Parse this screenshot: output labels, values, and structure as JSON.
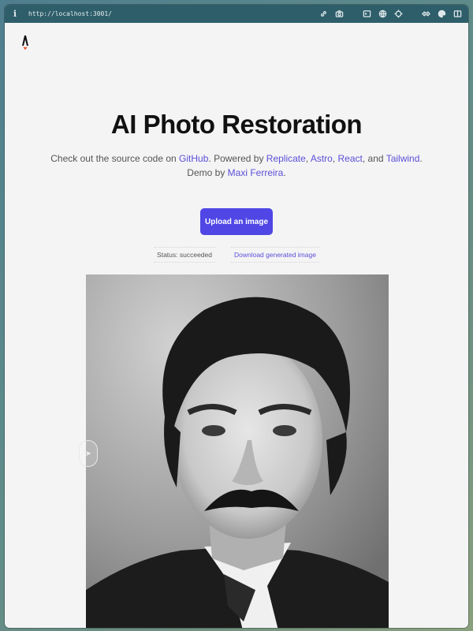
{
  "browser": {
    "url": "http://localhost:3001/",
    "icons": [
      "link-icon",
      "camera-icon",
      "terminal-icon",
      "globe-icon",
      "crosshair-icon",
      "code-icon",
      "palette-icon",
      "sidebar-icon"
    ]
  },
  "header": {
    "logo": "astro-logo-icon"
  },
  "main": {
    "title": "AI Photo Restoration",
    "description": {
      "prefix": "Check out the source code on ",
      "github": "GitHub",
      "powered": ". Powered by ",
      "replicate": "Replicate",
      "comma1": ", ",
      "astro": "Astro",
      "comma2": ", ",
      "react": "React",
      "and": ", and ",
      "tailwind": "Tailwind",
      "period": ".",
      "demo_prefix": "Demo by ",
      "author": "Maxi Ferreira",
      "end": "."
    },
    "upload_label": "Upload an image",
    "status": "Status: succeeded",
    "download_label": "Download generated image"
  },
  "colors": {
    "accent": "#4f46e5",
    "link": "#5b4fd6",
    "toolbar": "#2e5e6a"
  }
}
